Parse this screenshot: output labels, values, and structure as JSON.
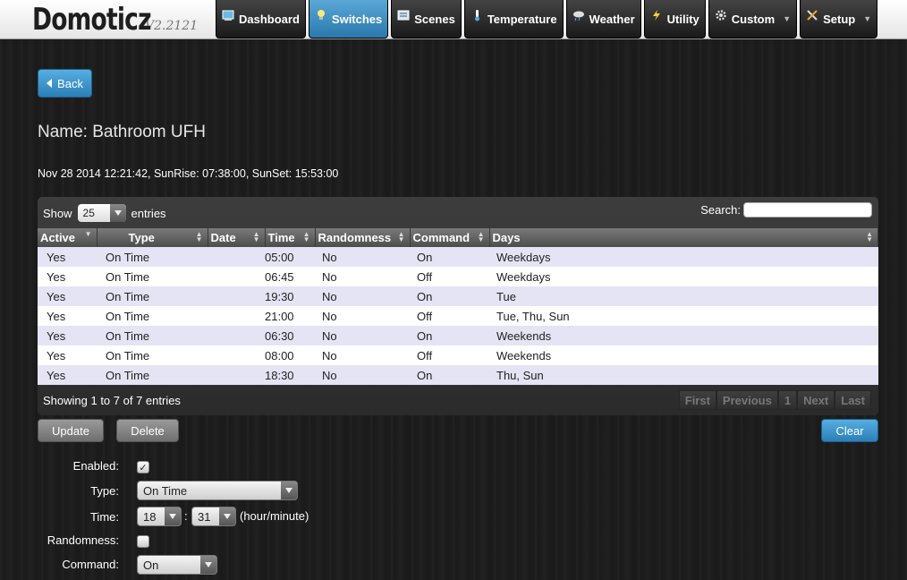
{
  "app": {
    "name": "Domoticz",
    "version": "V2.2121"
  },
  "nav": [
    {
      "label": "Dashboard",
      "icon": "dashboard-icon",
      "active": false
    },
    {
      "label": "Switches",
      "icon": "lightbulb-icon",
      "active": true
    },
    {
      "label": "Scenes",
      "icon": "scenes-icon",
      "active": false
    },
    {
      "label": "Temperature",
      "icon": "thermometer-icon",
      "active": false
    },
    {
      "label": "Weather",
      "icon": "weather-icon",
      "active": false
    },
    {
      "label": "Utility",
      "icon": "lightning-icon",
      "active": false
    },
    {
      "label": "Custom",
      "icon": "gear-icon",
      "active": false,
      "dropdown": true
    },
    {
      "label": "Setup",
      "icon": "tools-icon",
      "active": false,
      "dropdown": true
    }
  ],
  "back_label": "Back",
  "page_title": "Name: Bathroom UFH",
  "sun_info": "Nov 28 2014 12:21:42, SunRise: 07:38:00, SunSet: 15:53:00",
  "table": {
    "show_label": "Show",
    "entries_label": "entries",
    "page_size": "25",
    "search_label": "Search:",
    "search_value": "",
    "columns": [
      "Active",
      "Type",
      "Date",
      "Time",
      "Randomness",
      "Command",
      "Days"
    ],
    "rows": [
      [
        "Yes",
        "On Time",
        "",
        "05:00",
        "No",
        "On",
        "Weekdays"
      ],
      [
        "Yes",
        "On Time",
        "",
        "06:45",
        "No",
        "Off",
        "Weekdays"
      ],
      [
        "Yes",
        "On Time",
        "",
        "19:30",
        "No",
        "On",
        "Tue"
      ],
      [
        "Yes",
        "On Time",
        "",
        "21:00",
        "No",
        "Off",
        "Tue, Thu, Sun"
      ],
      [
        "Yes",
        "On Time",
        "",
        "06:30",
        "No",
        "On",
        "Weekends"
      ],
      [
        "Yes",
        "On Time",
        "",
        "08:00",
        "No",
        "Off",
        "Weekends"
      ],
      [
        "Yes",
        "On Time",
        "",
        "18:30",
        "No",
        "On",
        "Thu, Sun"
      ]
    ],
    "info": "Showing 1 to 7 of 7 entries",
    "pager": {
      "first": "First",
      "previous": "Previous",
      "page": "1",
      "next": "Next",
      "last": "Last"
    }
  },
  "buttons": {
    "update": "Update",
    "delete": "Delete",
    "clear": "Clear"
  },
  "form": {
    "enabled_label": "Enabled:",
    "enabled_checked": true,
    "check_mark": "✓",
    "type_label": "Type:",
    "type_value": "On Time",
    "time_label": "Time:",
    "hour_value": "18",
    "minute_value": "31",
    "time_separator": ":",
    "time_hint": "(hour/minute)",
    "randomness_label": "Randomness:",
    "randomness_checked": false,
    "command_label": "Command:",
    "command_value": "On"
  },
  "colors": {
    "accent": "#2b7fb8",
    "row_odd": "#e4e4f5",
    "row_even": "#ffffff"
  }
}
